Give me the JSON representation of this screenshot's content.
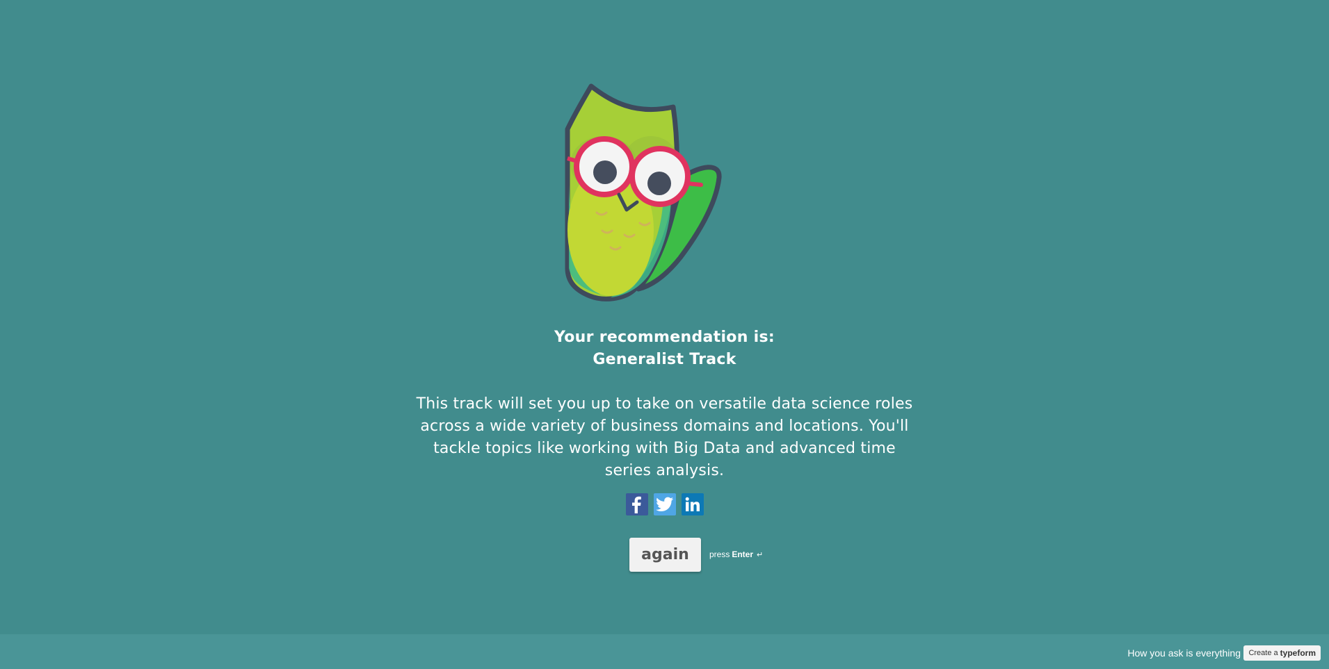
{
  "result": {
    "title_line1": "Your recommendation is:",
    "title_line2": "Generalist Track",
    "description": "This track will set you up to take on versatile data science roles across a wide variety of business domains and locations. You'll tackle topics like working with Big Data and advanced time series analysis."
  },
  "share": {
    "facebook_icon": "facebook-icon",
    "twitter_icon": "twitter-icon",
    "linkedin_icon": "linkedin-icon"
  },
  "actions": {
    "again_label": "again",
    "hint_press": "press",
    "hint_key": "Enter",
    "hint_symbol": "↵"
  },
  "footer": {
    "tagline": "How you ask is everything",
    "create_prefix": "Create a",
    "create_brand": "typeform"
  },
  "colors": {
    "background": "#418c8d",
    "footer": "#4a9597",
    "button": "#f1f1f1",
    "facebook": "#3b5a9a",
    "twitter": "#4fa6e5",
    "linkedin": "#0d79b5"
  }
}
